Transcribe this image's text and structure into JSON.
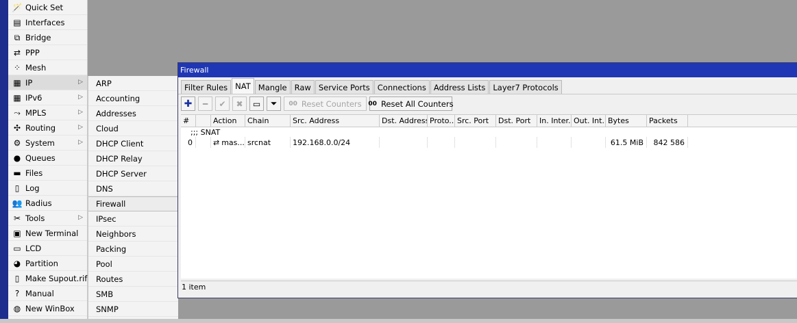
{
  "main_menu": [
    {
      "label": "Quick Set",
      "icon": "quick-set-icon",
      "glyph": "🪄",
      "arrow": false
    },
    {
      "label": "Interfaces",
      "icon": "interfaces-icon",
      "glyph": "▤",
      "arrow": false
    },
    {
      "label": "Bridge",
      "icon": "bridge-icon",
      "glyph": "⧉",
      "arrow": false
    },
    {
      "label": "PPP",
      "icon": "ppp-icon",
      "glyph": "⇄",
      "arrow": false
    },
    {
      "label": "Mesh",
      "icon": "mesh-icon",
      "glyph": "⁘",
      "arrow": false
    },
    {
      "label": "IP",
      "icon": "ip-icon",
      "glyph": "▦",
      "arrow": true
    },
    {
      "label": "IPv6",
      "icon": "ipv6-icon",
      "glyph": "▦",
      "arrow": true
    },
    {
      "label": "MPLS",
      "icon": "mpls-icon",
      "glyph": "⤳",
      "arrow": true
    },
    {
      "label": "Routing",
      "icon": "routing-icon",
      "glyph": "✣",
      "arrow": true
    },
    {
      "label": "System",
      "icon": "system-icon",
      "glyph": "⚙",
      "arrow": true
    },
    {
      "label": "Queues",
      "icon": "queues-icon",
      "glyph": "●",
      "arrow": false
    },
    {
      "label": "Files",
      "icon": "files-icon",
      "glyph": "▬",
      "arrow": false
    },
    {
      "label": "Log",
      "icon": "log-icon",
      "glyph": "▯",
      "arrow": false
    },
    {
      "label": "Radius",
      "icon": "radius-icon",
      "glyph": "👥",
      "arrow": false
    },
    {
      "label": "Tools",
      "icon": "tools-icon",
      "glyph": "✂",
      "arrow": true
    },
    {
      "label": "New Terminal",
      "icon": "terminal-icon",
      "glyph": "▣",
      "arrow": false
    },
    {
      "label": "LCD",
      "icon": "lcd-icon",
      "glyph": "▭",
      "arrow": false
    },
    {
      "label": "Partition",
      "icon": "partition-icon",
      "glyph": "◕",
      "arrow": false
    },
    {
      "label": "Make Supout.rif",
      "icon": "supout-icon",
      "glyph": "▯",
      "arrow": false
    },
    {
      "label": "Manual",
      "icon": "manual-icon",
      "glyph": "?",
      "arrow": false
    },
    {
      "label": "New WinBox",
      "icon": "winbox-icon",
      "glyph": "◍",
      "arrow": false
    }
  ],
  "sub_menu": [
    "ARP",
    "Accounting",
    "Addresses",
    "Cloud",
    "DHCP Client",
    "DHCP Relay",
    "DHCP Server",
    "DNS",
    "Firewall",
    "IPsec",
    "Neighbors",
    "Packing",
    "Pool",
    "Routes",
    "SMB",
    "SNMP"
  ],
  "window": {
    "title": "Firewall",
    "tabs": [
      "Filter Rules",
      "NAT",
      "Mangle",
      "Raw",
      "Service Ports",
      "Connections",
      "Address Lists",
      "Layer7 Protocols"
    ],
    "active_tab": "NAT",
    "toolbar": {
      "add_glyph": "✚",
      "remove_glyph": "━",
      "enable_glyph": "✔",
      "disable_glyph": "✖",
      "comment_glyph": "▭",
      "filter_glyph": "⏷",
      "reset_counters_icon": "00",
      "reset_counters_label": "Reset Counters",
      "reset_all_icon": "00",
      "reset_all_label": "Reset All Counters"
    },
    "columns": [
      "#",
      "",
      "Action",
      "Chain",
      "Src. Address",
      "Dst. Address",
      "Proto...",
      "Src. Port",
      "Dst. Port",
      "In. Inter...",
      "Out. Int...",
      "Bytes",
      "Packets"
    ],
    "group": ";;; SNAT",
    "rows": [
      {
        "num": "0",
        "flag": "",
        "action_icon": "⇄",
        "action": "mas...",
        "chain": "srcnat",
        "src": "192.168.0.0/24",
        "dst": "",
        "proto": "",
        "sport": "",
        "dport": "",
        "inif": "",
        "outif": "",
        "bytes": "61.5 MiB",
        "packets": "842 586"
      }
    ],
    "status": "1 item"
  }
}
